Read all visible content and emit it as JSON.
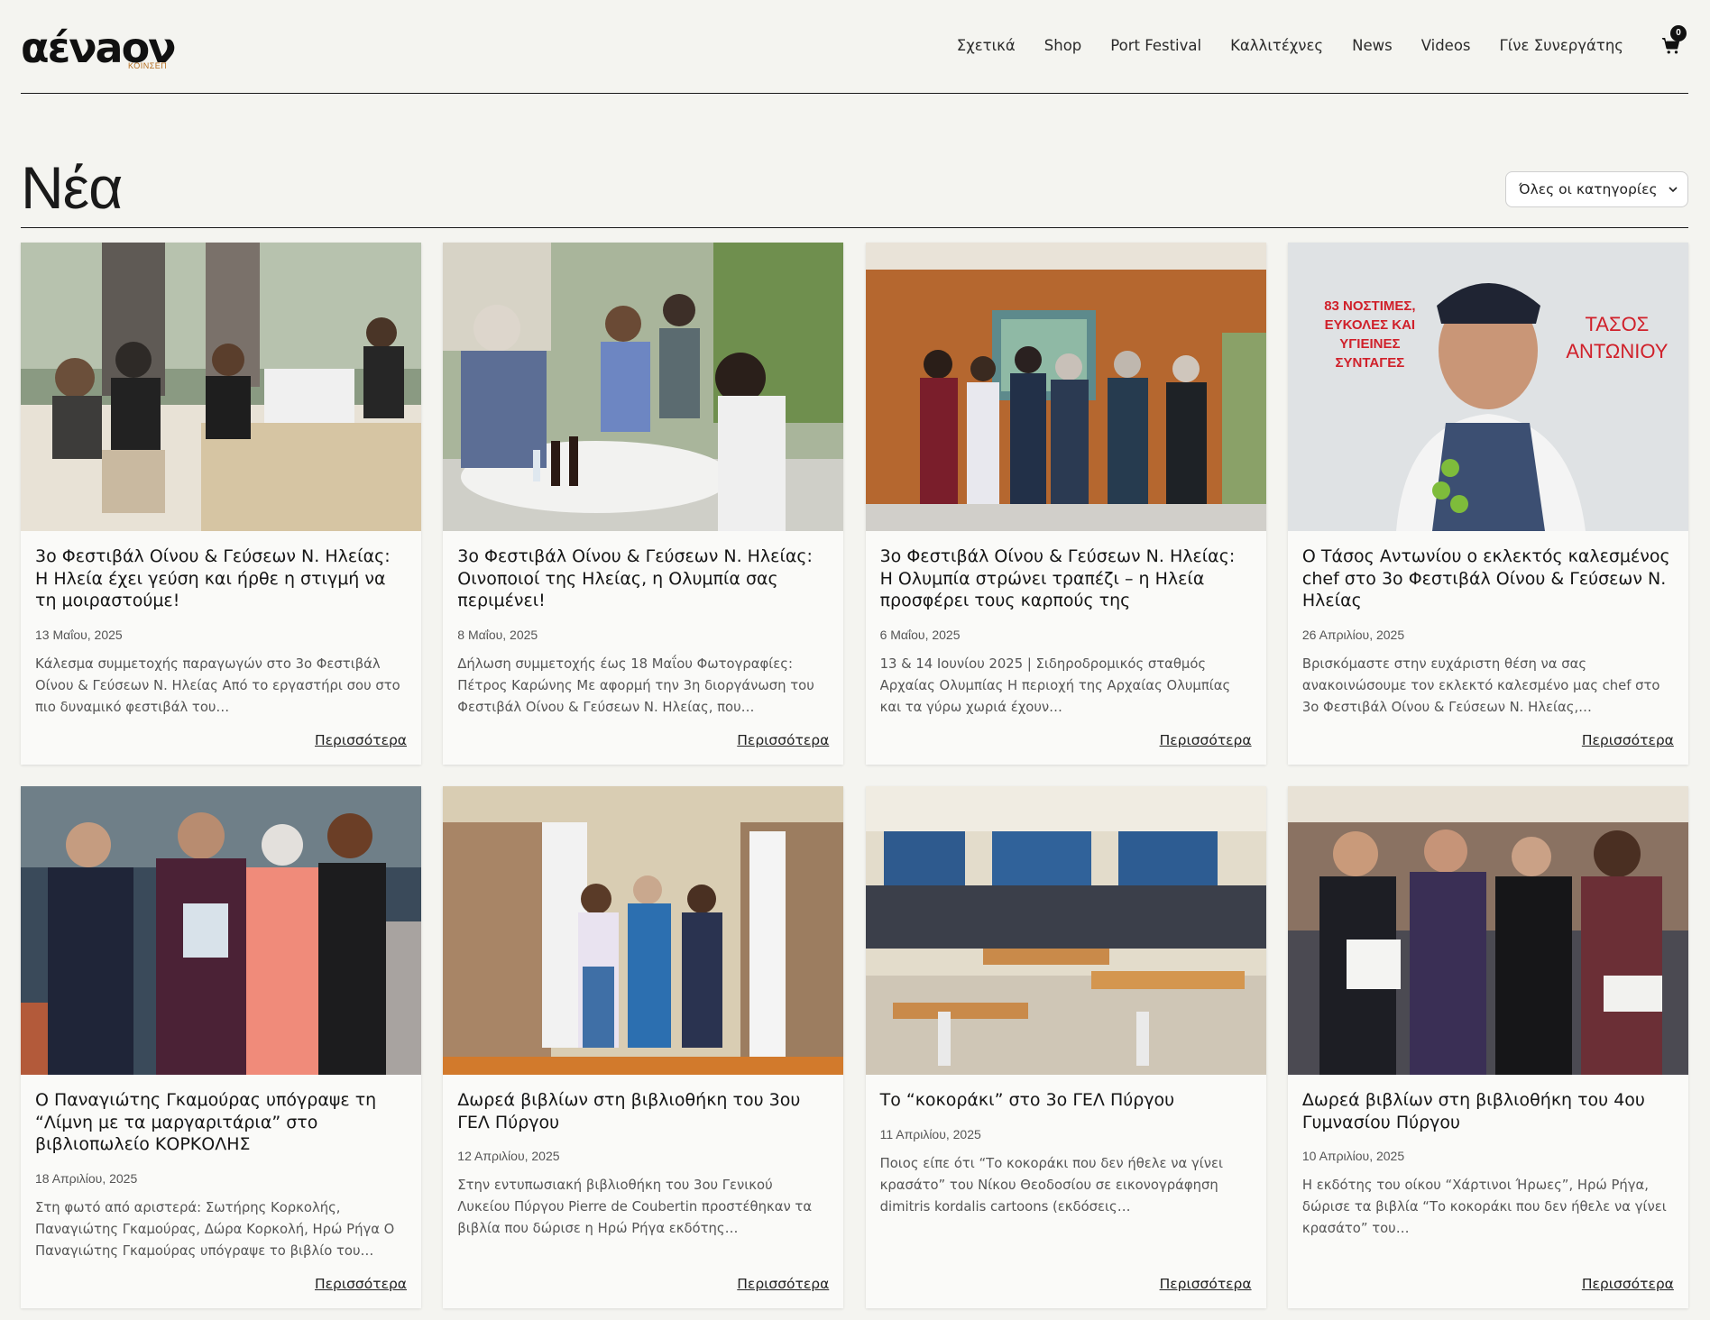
{
  "brand": {
    "logo_text": "αένaον",
    "logo_subtitle": "ΚΟΙΝΣΕΠ"
  },
  "nav": {
    "items": [
      {
        "label": "Σχετικά"
      },
      {
        "label": "Shop"
      },
      {
        "label": "Port Festival"
      },
      {
        "label": "Καλλιτέχνες"
      },
      {
        "label": "News"
      },
      {
        "label": "Videos"
      },
      {
        "label": "Γίνε Συνεργάτης"
      }
    ],
    "cart_count": "0",
    "cart_icon": "shopping-cart-icon"
  },
  "page": {
    "title": "Νέα",
    "category_filter": {
      "selected": "Όλες οι κατηγορίες",
      "icon": "chevron-down-icon"
    }
  },
  "colors": {
    "background": "#f4f4f0",
    "card": "#fafaf8",
    "text": "#1a1a1a",
    "logo_accent": "#b56d1f"
  },
  "posts": [
    {
      "title": "3ο Φεστιβάλ Οίνου & Γεύσεων Ν. Ηλείας: Η Ηλεία έχει γεύση και ήρθε η στιγμή να τη μοιραστούμε!",
      "date": "13 Μαΐου, 2025",
      "excerpt": "Κάλεσμα συμμετοχής παραγωγών στο 3ο Φεστιβάλ Οίνου & Γεύσεων Ν. Ηλείας Από το εργαστήρι σου στο πιο δυναμικό φεστιβάλ του…",
      "more": "Περισσότερα"
    },
    {
      "title": "3ο Φεστιβάλ Οίνου & Γεύσεων Ν. Ηλείας: Οινοποιοί της Ηλείας, η Ολυμπία σας περιμένει!",
      "date": "8 Μαΐου, 2025",
      "excerpt": "Δήλωση συμμετοχής έως 18 Μαΐου Φωτογραφίες: Πέτρος Καρώνης Με αφορμή την 3η διοργάνωση του Φεστιβάλ Οίνου & Γεύσεων Ν. Ηλείας, που…",
      "more": "Περισσότερα"
    },
    {
      "title": "3ο Φεστιβάλ Οίνου & Γεύσεων Ν. Ηλείας: Η Ολυμπία στρώνει τραπέζι – η Ηλεία προσφέρει τους καρπούς της",
      "date": "6 Μαΐου, 2025",
      "excerpt": "13 & 14 Ιουνίου 2025 | Σιδηροδρομικός σταθμός Αρχαίας Ολυμπίας Η περιοχή της Αρχαίας Ολυμπίας και τα γύρω χωριά έχουν…",
      "more": "Περισσότερα"
    },
    {
      "title": "Ο Τάσος Αντωνίου ο εκλεκτός καλεσμένος chef στο 3ο Φεστιβάλ Οίνου & Γεύσεων Ν. Ηλείας",
      "date": "26 Απριλίου, 2025",
      "excerpt": "Βρισκόμαστε στην ευχάριστη θέση να σας ανακοινώσουμε τον εκλεκτό καλεσμένο μας chef στο 3ο Φεστιβάλ Οίνου & Γεύσεων Ν. Ηλείας,…",
      "more": "Περισσότερα",
      "image_text": {
        "left": "83 ΝΟΣΤΙΜΕΣ, ΕΥΚΟΛΕΣ ΚΑΙ ΥΓΙΕΙΝΕΣ ΣΥΝΤΑΓΕΣ",
        "right": "ΤΑΣΟΣ ΑΝΤΩΝΙΟΥ"
      }
    },
    {
      "title": "Ο Παναγιώτης Γκαμούρας υπόγραψε τη “Λίμνη με τα μαργαριτάρια” στο βιβλιοπωλείο ΚΟΡΚΟΛΗΣ",
      "date": "18 Απριλίου, 2025",
      "excerpt": "  Στη φωτό από αριστερά: Σωτήρης Κορκολής, Παναγιώτης Γκαμούρας, Δώρα Κορκολή, Ηρώ Ρήγα Ο Παναγιώτης Γκαμούρας υπόγραψε το βιβλίο του…",
      "more": "Περισσότερα"
    },
    {
      "title": "Δωρεά βιβλίων στη βιβλιοθήκη του 3ου ΓΕΛ Πύργου",
      "date": "12 Απριλίου, 2025",
      "excerpt": "Στην εντυπωσιακή βιβλιοθήκη του 3ου Γενικού Λυκείου Πύργου Pierre de Coubertin προστέθηκαν τα βιβλία που δώρισε η Ηρώ Ρήγα εκδότης…",
      "more": "Περισσότερα"
    },
    {
      "title": "Το “κοκοράκι” στο 3ο ΓΕΛ Πύργου",
      "date": "11 Απριλίου, 2025",
      "excerpt": "Ποιος είπε ότι “Το κοκοράκι που δεν ήθελε να γίνει κρασάτο” του Νίκου Θεοδοσίου σε εικονογράφηση dimitris kordalis cartoons (εκδόσεις…",
      "more": "Περισσότερα"
    },
    {
      "title": "Δωρεά βιβλίων στη βιβλιοθήκη του 4ου Γυμνασίου Πύργου",
      "date": "10 Απριλίου, 2025",
      "excerpt": "Η εκδότης του οίκου “Χάρτινοι Ήρωες”, Ηρώ Ρήγα, δώρισε τα βιβλία “Το κοκοράκι που δεν ήθελε να γίνει κρασάτο” του…",
      "more": "Περισσότερα"
    }
  ]
}
